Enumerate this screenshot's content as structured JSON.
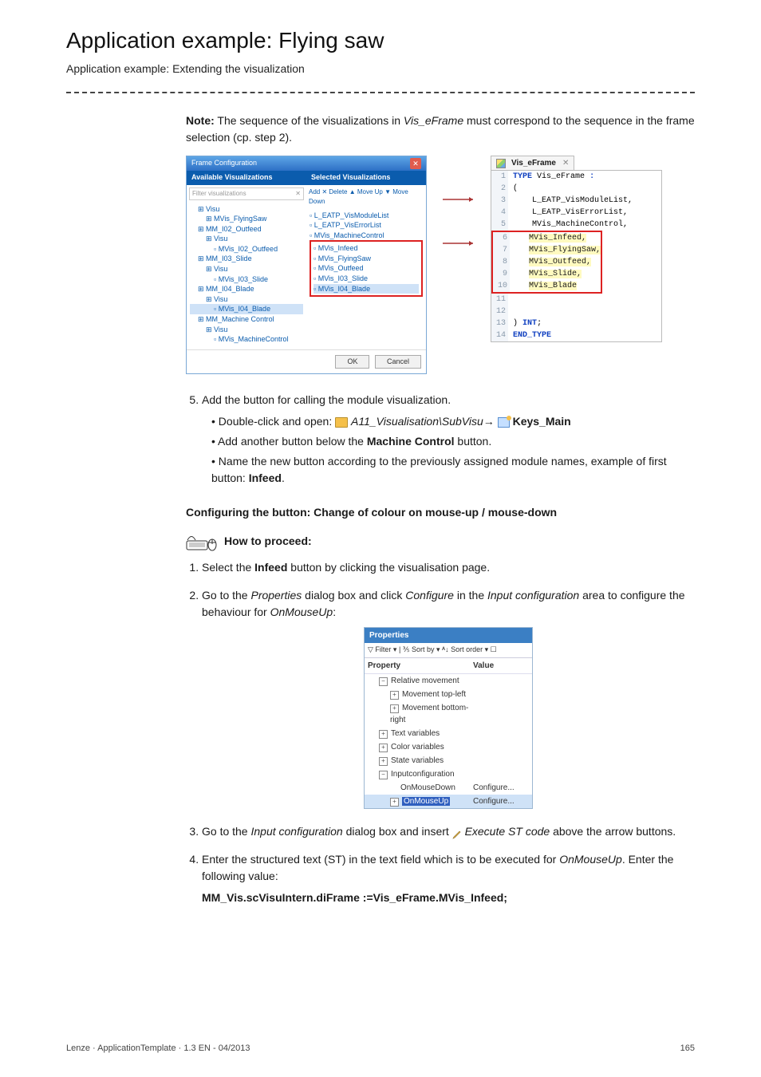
{
  "heading": "Application example: Flying saw",
  "subheading": "Application example: Extending the visualization",
  "note": {
    "label": "Note:",
    "text_a": "The sequence of the visualizations in ",
    "em1": "Vis_eFrame",
    "text_b": " must correspond to the sequence in the frame selection (cp. step 2)."
  },
  "frame_config": {
    "title": "Frame Configuration",
    "available": "Available Visualizations",
    "selected": "Selected Visualizations",
    "filter_placeholder": "Filter visualizations",
    "tree": [
      {
        "lvl": 1,
        "txt": "Visu"
      },
      {
        "lvl": 2,
        "txt": "MVis_FlyingSaw"
      },
      {
        "lvl": 1,
        "txt": "MM_I02_Outfeed"
      },
      {
        "lvl": 2,
        "txt": "Visu"
      },
      {
        "lvl": 3,
        "txt": "MVis_I02_Outfeed"
      },
      {
        "lvl": 1,
        "txt": "MM_I03_Slide"
      },
      {
        "lvl": 2,
        "txt": "Visu"
      },
      {
        "lvl": 3,
        "txt": "MVis_I03_Slide"
      },
      {
        "lvl": 1,
        "txt": "MM_I04_Blade"
      },
      {
        "lvl": 2,
        "txt": "Visu"
      },
      {
        "lvl": 3,
        "txt": "MVis_I04_Blade",
        "hl": true
      },
      {
        "lvl": 1,
        "txt": "MM_Machine Control"
      },
      {
        "lvl": 2,
        "txt": "Visu"
      },
      {
        "lvl": 3,
        "txt": "MVis_MachineControl"
      }
    ],
    "sel_toolbar": "Add  ✕ Delete  ▲ Move Up  ▼ Move Down",
    "sel_list_top": [
      "L_EATP_VisModuleList",
      "L_EATP_VisErrorList",
      "MVis_MachineControl"
    ],
    "sel_list_box": [
      "MVis_Infeed",
      "MVis_FlyingSaw",
      "MVis_Outfeed",
      "MVis_I03_Slide",
      "MVis_I04_Blade"
    ],
    "ok": "OK",
    "cancel": "Cancel"
  },
  "code_tab": {
    "label": "Vis_eFrame",
    "lines": [
      {
        "n": 1,
        "t": "TYPE Vis_eFrame :",
        "cls": "type"
      },
      {
        "n": 2,
        "t": "(",
        "cls": ""
      },
      {
        "n": 3,
        "t": "    L_EATP_VisModuleList,",
        "cls": ""
      },
      {
        "n": 4,
        "t": "    L_EATP_VisErrorList,",
        "cls": ""
      },
      {
        "n": 5,
        "t": "    MVis_MachineControl,",
        "cls": ""
      },
      {
        "n": 6,
        "t": "    MVis_Infeed,",
        "cls": "new"
      },
      {
        "n": 7,
        "t": "    MVis_FlyingSaw,",
        "cls": "new"
      },
      {
        "n": 8,
        "t": "    MVis_Outfeed,",
        "cls": "new"
      },
      {
        "n": 9,
        "t": "    MVis_Slide,",
        "cls": "new"
      },
      {
        "n": 10,
        "t": "    MVis_Blade",
        "cls": "new last"
      },
      {
        "n": 11,
        "t": "",
        "cls": ""
      },
      {
        "n": 12,
        "t": "",
        "cls": ""
      },
      {
        "n": 13,
        "t": ") INT;",
        "cls": "kw"
      },
      {
        "n": 14,
        "t": "END_TYPE",
        "cls": "kw"
      }
    ]
  },
  "step5": {
    "num": "5.",
    "text": "Add the button for calling the module visualization.",
    "bullets": {
      "b1a": "Double-click and open: ",
      "b1path_a": "A11_Visualisation\\SubVisu",
      "b1arrow": "→",
      "b1path_b": "Keys_Main",
      "b2a": "Add another button below the ",
      "b2b": "Machine Control",
      "b2c": " button.",
      "b3a": "Name the new button according to the previously assigned module names, example of first button: ",
      "b3b": "Infeed",
      "b3c": "."
    }
  },
  "section2_title": "Configuring the button: Change of colour on mouse-up / mouse-down",
  "howto": "How to proceed:",
  "steps2": {
    "s1a": "Select the ",
    "s1b": "Infeed",
    "s1c": " button by clicking the visualisation page.",
    "s2a": "Go to the ",
    "s2b": "Properties",
    "s2c": " dialog box and click ",
    "s2d": "Configure",
    "s2e": " in the ",
    "s2f": "Input configuration",
    "s2g": " area to configure the behaviour for ",
    "s2h": "OnMouseUp",
    "s2i": ":",
    "s3a": "Go to the ",
    "s3b": "Input configuration",
    "s3c": " dialog box and insert ",
    "s3d": "Execute ST code",
    "s3e": " above the arrow buttons.",
    "s4a": "Enter the structured text (ST) in the text field which is to be executed for ",
    "s4b": "OnMouseUp",
    "s4c": ". Enter the following value:",
    "s4code": "MM_Vis.scVisuIntern.diFrame :=Vis_eFrame.MVis_Infeed;"
  },
  "props": {
    "title": "Properties",
    "tools": "▽ Filter ▾ | ⅗ Sort by ▾ ᴬ↓ Sort order ▾ ☐",
    "col1": "Property",
    "col2": "Value",
    "rows": [
      {
        "exp": "−",
        "txt": "Relative movement",
        "ind": 0
      },
      {
        "exp": "+",
        "txt": "Movement top-left",
        "ind": 1
      },
      {
        "exp": "+",
        "txt": "Movement bottom-right",
        "ind": 1
      },
      {
        "exp": "+",
        "txt": "Text variables",
        "ind": 0
      },
      {
        "exp": "+",
        "txt": "Color variables",
        "ind": 0
      },
      {
        "exp": "+",
        "txt": "State variables",
        "ind": 0
      },
      {
        "exp": "−",
        "txt": "Inputconfiguration",
        "ind": 0
      },
      {
        "exp": "",
        "txt": "OnMouseDown",
        "ind": 1,
        "val": "Configure..."
      },
      {
        "exp": "+",
        "txt": "OnMouseUp",
        "ind": 1,
        "val": "Configure...",
        "sel": true
      }
    ]
  },
  "footer_left": "Lenze · ApplicationTemplate · 1.3 EN - 04/2013",
  "footer_right": "165"
}
